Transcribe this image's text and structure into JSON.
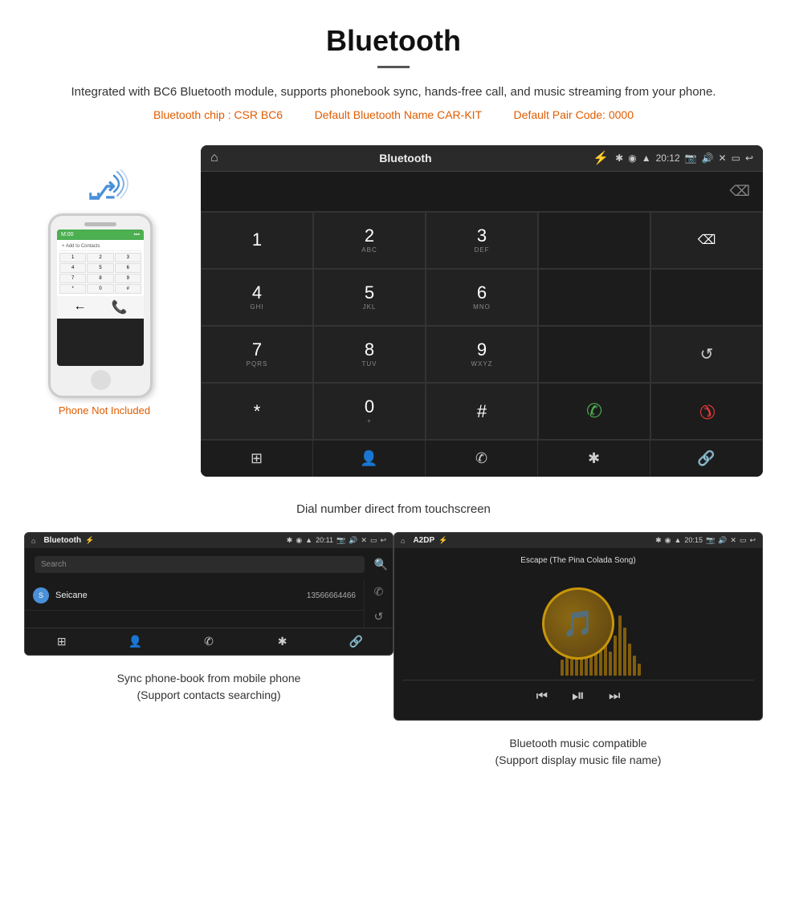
{
  "header": {
    "title": "Bluetooth",
    "description": "Integrated with BC6 Bluetooth module, supports phonebook sync, hands-free call, and music streaming from your phone.",
    "specs": {
      "chip": "Bluetooth chip : CSR BC6",
      "name": "Default Bluetooth Name CAR-KIT",
      "code": "Default Pair Code: 0000"
    }
  },
  "phone": {
    "not_included_label": "Phone Not Included"
  },
  "car_screen": {
    "status": {
      "title": "Bluetooth",
      "time": "20:12"
    },
    "dialpad": {
      "keys": [
        {
          "main": "1",
          "sub": ""
        },
        {
          "main": "2",
          "sub": "ABC"
        },
        {
          "main": "3",
          "sub": "DEF"
        },
        {
          "main": "",
          "sub": ""
        },
        {
          "main": "⌫",
          "sub": ""
        }
      ],
      "row2": [
        {
          "main": "4",
          "sub": "GHI"
        },
        {
          "main": "5",
          "sub": "JKL"
        },
        {
          "main": "6",
          "sub": "MNO"
        },
        {
          "main": "",
          "sub": ""
        },
        {
          "main": "",
          "sub": ""
        }
      ],
      "row3": [
        {
          "main": "7",
          "sub": "PQRS"
        },
        {
          "main": "8",
          "sub": "TUV"
        },
        {
          "main": "9",
          "sub": "WXYZ"
        },
        {
          "main": "",
          "sub": ""
        },
        {
          "main": "↺",
          "sub": ""
        }
      ],
      "row4": [
        {
          "main": "*",
          "sub": ""
        },
        {
          "main": "0",
          "sub": "+"
        },
        {
          "main": "#",
          "sub": ""
        },
        {
          "main": "📞",
          "sub": "call"
        },
        {
          "main": "📵",
          "sub": "end"
        }
      ]
    }
  },
  "screen_caption": "Dial number direct from touchscreen",
  "phonebook": {
    "status_title": "Bluetooth",
    "time": "20:11",
    "search_placeholder": "Search",
    "contact": {
      "letter": "S",
      "name": "Seicane",
      "number": "13566664466"
    }
  },
  "music": {
    "status_title": "A2DP",
    "time": "20:15",
    "song_title": "Escape (The Pina Colada Song)"
  },
  "bottom_captions": {
    "left": "Sync phone-book from mobile phone\n(Support contacts searching)",
    "right": "Bluetooth music compatible\n(Support display music file name)"
  }
}
